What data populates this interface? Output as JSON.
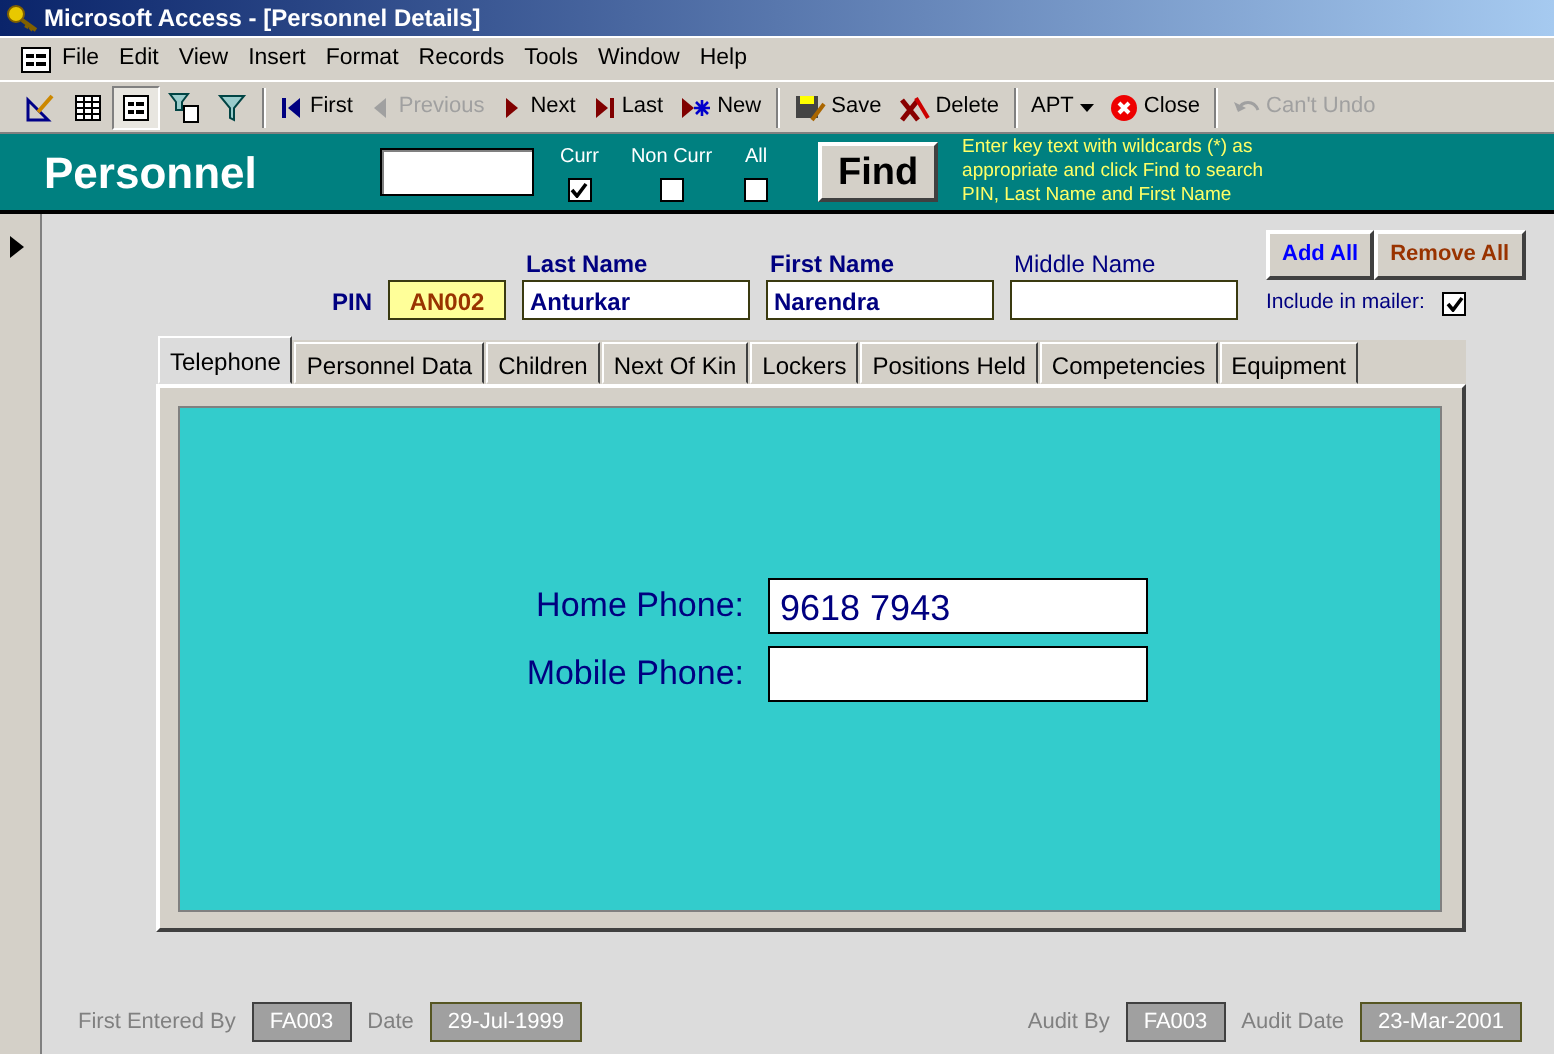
{
  "window": {
    "title": "Microsoft Access - [Personnel Details]"
  },
  "menu": [
    "File",
    "Edit",
    "View",
    "Insert",
    "Format",
    "Records",
    "Tools",
    "Window",
    "Help"
  ],
  "view_buttons": [
    {
      "kind": "design",
      "selected": false
    },
    {
      "kind": "datasheet",
      "selected": false
    },
    {
      "kind": "form",
      "selected": true
    },
    {
      "kind": "filter-form",
      "selected": false
    },
    {
      "kind": "filter",
      "selected": false
    }
  ],
  "toolbar": [
    {
      "kind": "first",
      "label": "First",
      "disabled": false
    },
    {
      "kind": "previous",
      "label": "Previous",
      "disabled": true
    },
    {
      "kind": "next",
      "label": "Next",
      "disabled": false
    },
    {
      "kind": "last",
      "label": "Last",
      "disabled": false
    },
    {
      "kind": "new",
      "label": "New",
      "disabled": false
    },
    {
      "kind": "sep"
    },
    {
      "kind": "save",
      "label": "Save",
      "disabled": false
    },
    {
      "kind": "delete",
      "label": "Delete",
      "disabled": false
    },
    {
      "kind": "sep"
    },
    {
      "kind": "dropdown",
      "label": "APT",
      "disabled": false
    },
    {
      "kind": "close",
      "label": "Close",
      "disabled": false
    },
    {
      "kind": "sep"
    },
    {
      "kind": "undo",
      "label": "Can't Undo",
      "disabled": true
    }
  ],
  "header": {
    "title": "Personnel",
    "filters": [
      {
        "label": "Curr",
        "checked": true
      },
      {
        "label": "Non Curr",
        "checked": false
      },
      {
        "label": "All",
        "checked": false
      }
    ],
    "find_button": "Find",
    "hint": "Enter key text with wildcards (*) as appropriate and click Find to search PIN, Last Name and First Name"
  },
  "pin": {
    "label": "PIN",
    "value": "AN002"
  },
  "name_fields": [
    {
      "label": "Last Name",
      "value": "Anturkar",
      "bold": true
    },
    {
      "label": "First Name",
      "value": "Narendra",
      "bold": true
    },
    {
      "label": "Middle Name",
      "bold": false
    }
  ],
  "buttons": [
    {
      "label": "Add All",
      "color": "#0000ff"
    },
    {
      "label": "Remove All",
      "color": "#993300"
    }
  ],
  "include_in_mailer": {
    "label": "Include in mailer:",
    "checked": true
  },
  "tabs": [
    {
      "label": "Telephone",
      "selected": true
    },
    {
      "label": "Personnel Data",
      "selected": false
    },
    {
      "label": "Children",
      "selected": false
    },
    {
      "label": "Next Of Kin",
      "selected": false
    },
    {
      "label": "Lockers",
      "selected": false
    },
    {
      "label": "Positions Held",
      "selected": false
    },
    {
      "label": "Competencies",
      "selected": false
    },
    {
      "label": "Equipment",
      "selected": false
    }
  ],
  "phones": [
    {
      "label": "Home Phone:",
      "value": "9618 7943"
    },
    {
      "label": "Mobile Phone:"
    }
  ],
  "footer_left": [
    {
      "label": "First Entered By",
      "value": "FA003",
      "kind": "plain"
    },
    {
      "label": "Date",
      "value": "29-Jul-1999",
      "kind": "date"
    }
  ],
  "footer_right": [
    {
      "label": "Audit By",
      "value": "FA003",
      "kind": "plain"
    },
    {
      "label": "Audit Date",
      "value": "23-Mar-2001",
      "kind": "date"
    }
  ]
}
